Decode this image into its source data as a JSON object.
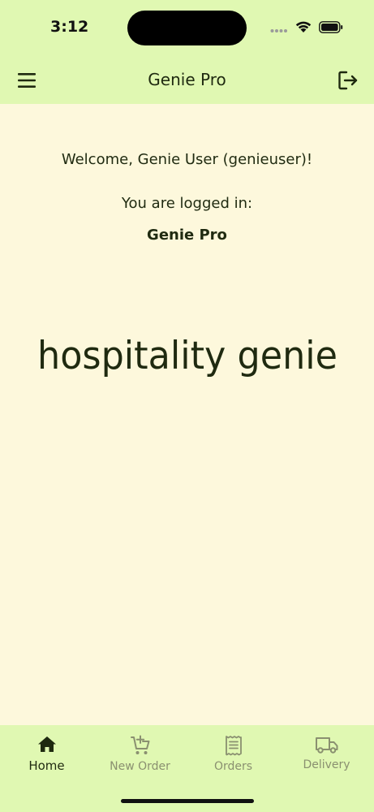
{
  "status_bar": {
    "time": "3:12"
  },
  "app_bar": {
    "title": "Genie Pro",
    "menu_icon": "hamburger-menu-icon",
    "logout_icon": "logout-icon"
  },
  "main": {
    "welcome": "Welcome, Genie User (genieuser)!",
    "logged_in_label": "You are logged in:",
    "app_name": "Genie Pro",
    "brand_logo_text": "hospitality genie"
  },
  "bottom_nav": {
    "items": [
      {
        "label": "Home",
        "icon": "home-icon",
        "active": true
      },
      {
        "label": "New Order",
        "icon": "add-cart-icon",
        "active": false
      },
      {
        "label": "Orders",
        "icon": "receipt-icon",
        "active": false
      },
      {
        "label": "Delivery",
        "icon": "truck-icon",
        "active": false
      }
    ]
  },
  "colors": {
    "bar_background": "#e0f8b2",
    "page_background": "#fdf8dc",
    "text": "#1f2a10",
    "inactive_nav": "#8a9070"
  }
}
